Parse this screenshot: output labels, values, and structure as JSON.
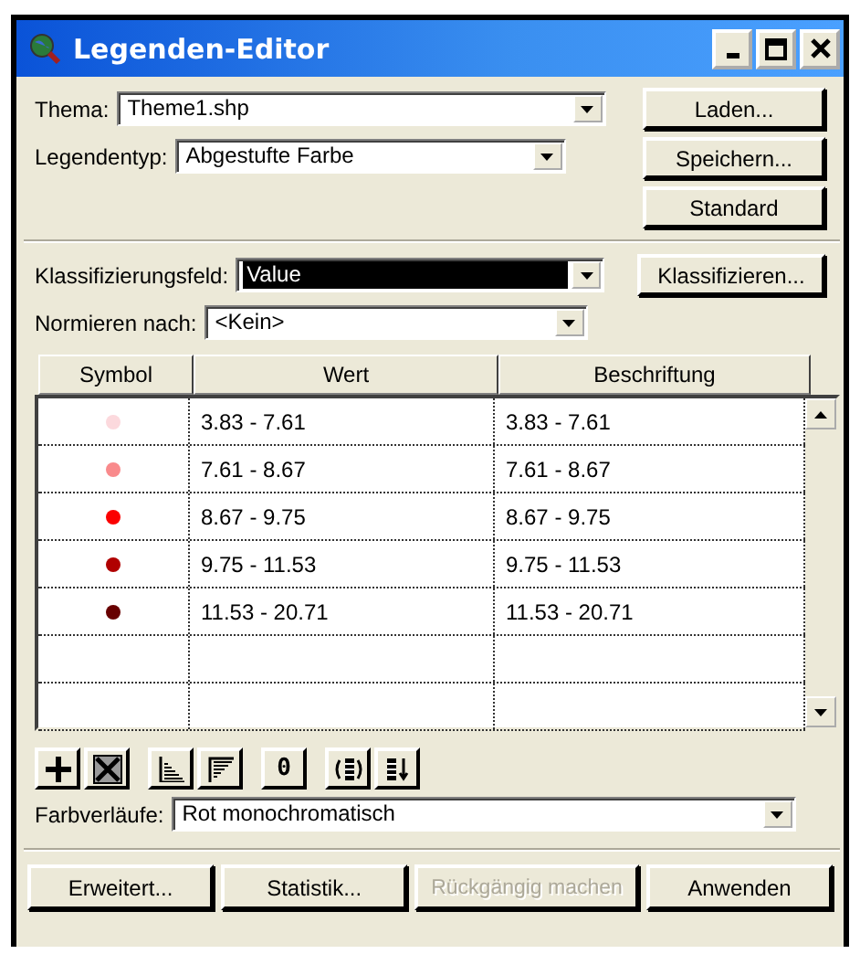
{
  "window": {
    "title": "Legenden-Editor"
  },
  "theme": {
    "label": "Thema:",
    "value": "Theme1.shp"
  },
  "legend_type": {
    "label": "Legendentyp:",
    "value": "Abgestufte Farbe"
  },
  "side_buttons": [
    {
      "label": "Laden..."
    },
    {
      "label": "Speichern..."
    },
    {
      "label": "Standard"
    }
  ],
  "classification_field": {
    "label": "Klassifizierungsfeld:",
    "value": "Value",
    "highlighted": true
  },
  "classify_button": {
    "label": "Klassifizieren..."
  },
  "normalize": {
    "label": "Normieren nach:",
    "value": "<Kein>"
  },
  "table": {
    "columns": [
      "Symbol",
      "Wert",
      "Beschriftung"
    ],
    "rows": [
      {
        "color": "#fcd9dd",
        "value": "3.83 - 7.61",
        "label": "3.83 - 7.61"
      },
      {
        "color": "#f98a8c",
        "value": "7.61 - 8.67",
        "label": "7.61 - 8.67"
      },
      {
        "color": "#fb0000",
        "value": "8.67 - 9.75",
        "label": "8.67 - 9.75"
      },
      {
        "color": "#b00000",
        "value": "9.75 - 11.53",
        "label": "9.75 - 11.53"
      },
      {
        "color": "#680000",
        "value": "11.53 - 20.71",
        "label": "11.53 - 20.71"
      }
    ]
  },
  "toolbar": [
    {
      "kind": "add"
    },
    {
      "kind": "delete"
    },
    {
      "kind": "sort-ascending"
    },
    {
      "kind": "sort-descending"
    },
    {
      "kind": "text",
      "label": "0"
    },
    {
      "kind": "reverse"
    },
    {
      "kind": "sort-field"
    }
  ],
  "color_ramp": {
    "label": "Farbverläufe:",
    "value": "Rot monochromatisch"
  },
  "bottom_buttons": [
    {
      "label": "Erweitert...",
      "disabled": false
    },
    {
      "label": "Statistik...",
      "disabled": false
    },
    {
      "label": "Rückgängig machen",
      "disabled": true
    },
    {
      "label": "Anwenden",
      "disabled": false
    }
  ]
}
